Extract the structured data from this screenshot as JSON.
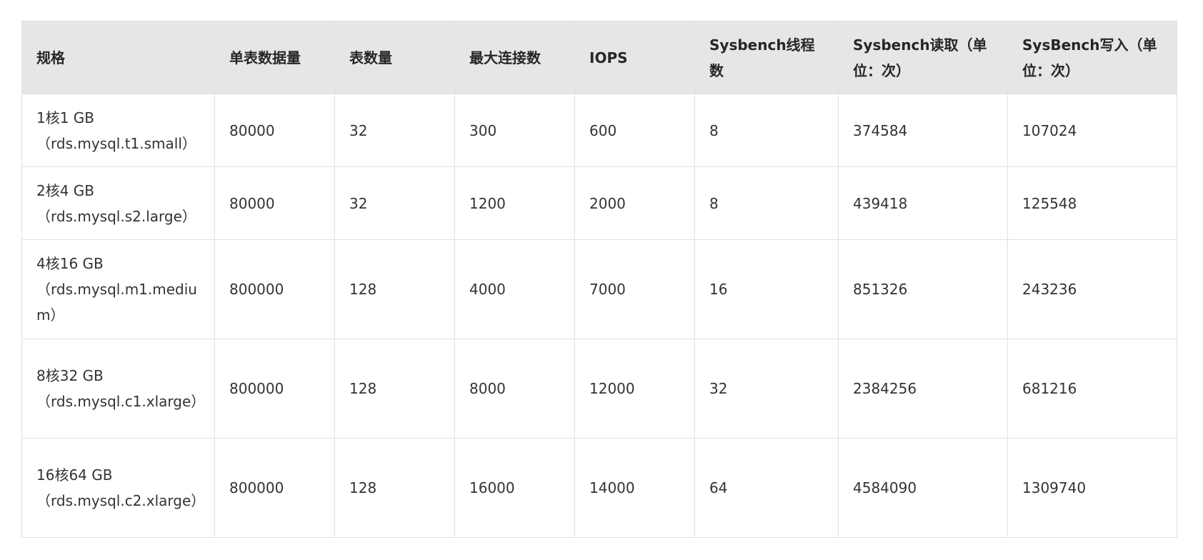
{
  "table": {
    "headers": [
      "规格",
      "单表数据量",
      "表数量",
      "最大连接数",
      "IOPS",
      "Sysbench线程数",
      "Sysbench读取（单位：次）",
      "SysBench写入（单位：次）"
    ],
    "rows": [
      {
        "spec_name": "1核1 GB",
        "spec_code": "（rds.mysql.t1.small）",
        "rows_per_table": "80000",
        "table_count": "32",
        "max_connections": "300",
        "iops": "600",
        "threads": "8",
        "read": "374584",
        "write": "107024"
      },
      {
        "spec_name": "2核4 GB",
        "spec_code": "（rds.mysql.s2.large）",
        "rows_per_table": "80000",
        "table_count": "32",
        "max_connections": "1200",
        "iops": "2000",
        "threads": "8",
        "read": "439418",
        "write": "125548"
      },
      {
        "spec_name": "4核16 GB",
        "spec_code": "（rds.mysql.m1.medium）",
        "rows_per_table": "800000",
        "table_count": "128",
        "max_connections": "4000",
        "iops": "7000",
        "threads": "16",
        "read": "851326",
        "write": "243236"
      },
      {
        "spec_name": "8核32 GB",
        "spec_code": "（rds.mysql.c1.xlarge）",
        "rows_per_table": "800000",
        "table_count": "128",
        "max_connections": "8000",
        "iops": "12000",
        "threads": "32",
        "read": "2384256",
        "write": "681216"
      },
      {
        "spec_name": "16核64 GB",
        "spec_code": "（rds.mysql.c2.xlarge）",
        "rows_per_table": "800000",
        "table_count": "128",
        "max_connections": "16000",
        "iops": "14000",
        "threads": "64",
        "read": "4584090",
        "write": "1309740"
      }
    ]
  }
}
